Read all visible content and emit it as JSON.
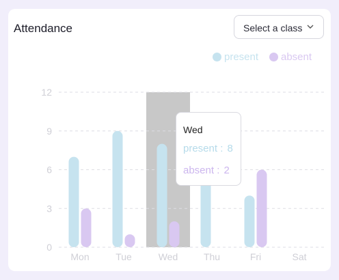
{
  "header": {
    "title": "Attendance"
  },
  "class_select": {
    "selected_label": "Select a class"
  },
  "colors": {
    "present": "#c6e3ef",
    "absent": "#d9c8f1",
    "highlight": "#c8c8c8",
    "tick": "#cfcfd6",
    "grid": "#dedee4"
  },
  "tooltip": {
    "day": "Wed",
    "present_label": "present : ",
    "present_value": "8",
    "absent_label": "absent : ",
    "absent_value": "2"
  },
  "chart_data": {
    "type": "bar",
    "categories": [
      "Mon",
      "Tue",
      "Wed",
      "Thu",
      "Fri",
      "Sat"
    ],
    "series": [
      {
        "name": "present",
        "values": [
          7,
          9,
          8,
          7,
          4,
          0
        ]
      },
      {
        "name": "absent",
        "values": [
          3,
          1,
          2,
          0,
          6,
          0
        ]
      }
    ],
    "yticks": [
      0,
      3,
      6,
      9,
      12
    ],
    "ylim": [
      0,
      12
    ],
    "grid": true,
    "legend_position": "top-right",
    "highlighted_category": "Wed"
  }
}
